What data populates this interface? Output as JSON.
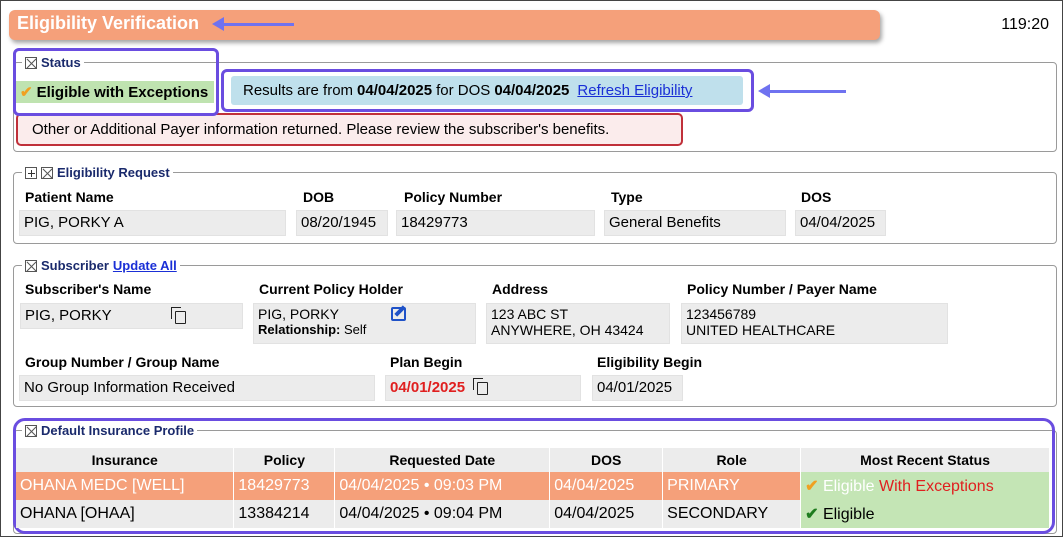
{
  "header": {
    "title": "Eligibility Verification",
    "clock": "119:20"
  },
  "status": {
    "legend": "Status",
    "eligibility_check": "✔",
    "eligibility_text": "Eligible with Exceptions",
    "results_prefix": "Results are from",
    "results_date": "04/04/2025",
    "results_mid": "for DOS",
    "results_dos": "04/04/2025",
    "refresh_link": "Refresh Eligibility",
    "alert": "Other or Additional Payer information returned. Please review the subscriber's benefits."
  },
  "request": {
    "legend": "Eligibility Request",
    "labels": {
      "patient": "Patient Name",
      "dob": "DOB",
      "policy": "Policy Number",
      "type": "Type",
      "dos": "DOS"
    },
    "values": {
      "patient": "PIG, PORKY A",
      "dob": "08/20/1945",
      "policy": "18429773",
      "type": "General Benefits",
      "dos": "04/04/2025"
    }
  },
  "subscriber": {
    "legend": "Subscriber",
    "update_all": "Update All",
    "labels": {
      "name": "Subscriber's Name",
      "holder": "Current Policy Holder",
      "address": "Address",
      "policy_payer": "Policy Number / Payer Name",
      "group": "Group Number / Group Name",
      "plan_begin": "Plan Begin",
      "elig_begin": "Eligibility Begin",
      "relationship": "Relationship:"
    },
    "values": {
      "name": "PIG, PORKY",
      "holder": "PIG, PORKY",
      "relationship": "Self",
      "address_line1": "123 ABC ST",
      "address_line2": "ANYWHERE, OH 43424",
      "policy_number": "123456789",
      "payer_name": "UNITED HEALTHCARE",
      "group": "No Group Information Received",
      "plan_begin": "04/01/2025",
      "elig_begin": "04/01/2025"
    }
  },
  "profile": {
    "legend": "Default Insurance Profile",
    "columns": [
      "Insurance",
      "Policy",
      "Requested Date",
      "DOS",
      "Role",
      "Most Recent Status"
    ],
    "rows": [
      {
        "insurance": "OHANA MEDC [WELL]",
        "policy": "18429773",
        "requested": "04/04/2025 • 09:03 PM",
        "dos": "04/04/2025",
        "role": "PRIMARY",
        "check": "✔",
        "status": "Eligible",
        "status_extra": "With Exceptions"
      },
      {
        "insurance": "OHANA [OHAA]",
        "policy": "13384214",
        "requested": "04/04/2025 • 09:04 PM",
        "dos": "04/04/2025",
        "role": "SECONDARY",
        "check": "✔",
        "status": "Eligible",
        "status_extra": ""
      }
    ]
  },
  "colors": {
    "header": "#f5a07a",
    "highlight": "#6a4de0",
    "eligible": "#bfe3b0",
    "alert_border": "#c0303a"
  }
}
